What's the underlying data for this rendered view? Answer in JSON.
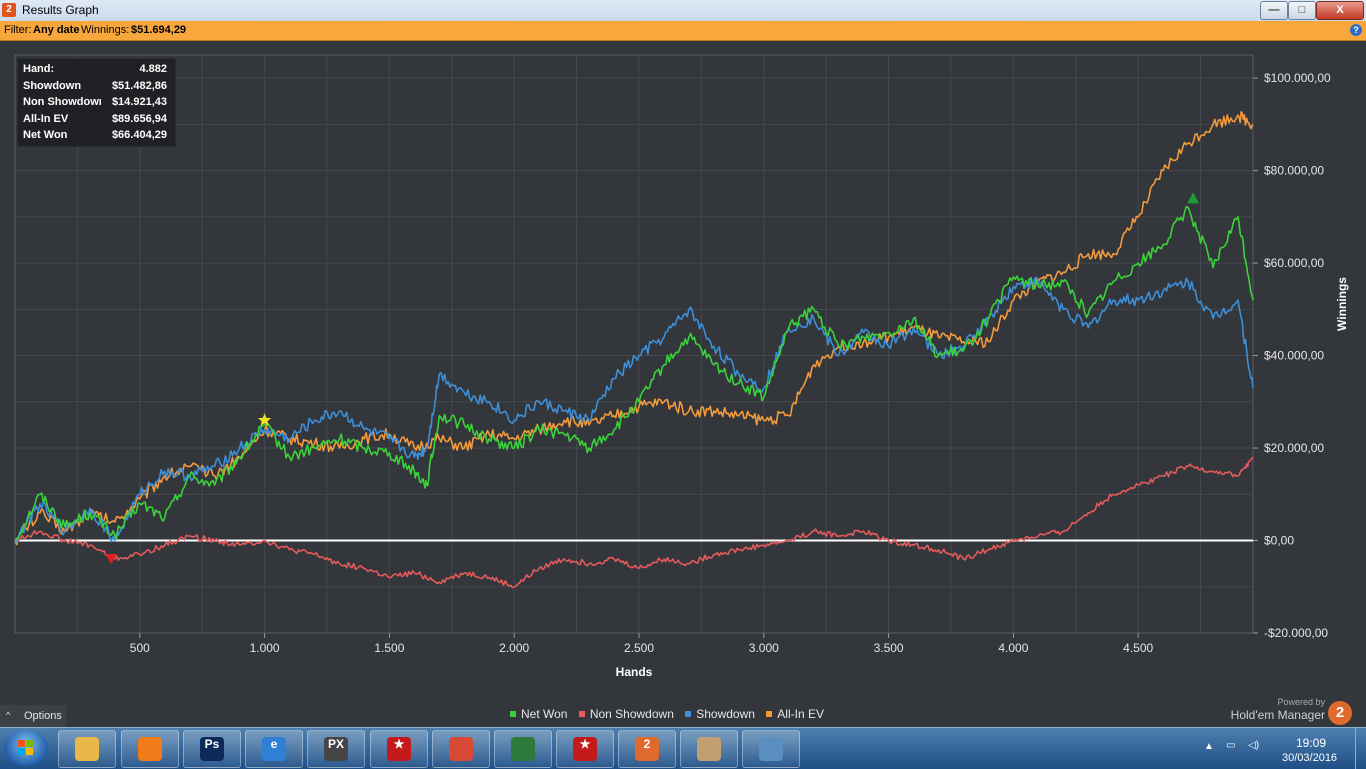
{
  "window": {
    "title": "Results Graph",
    "app_icon_text": "2",
    "buttons": {
      "minimize": "—",
      "maximize": "□",
      "close": "X"
    }
  },
  "filter_bar": {
    "filter_label": "Filter:",
    "filter_value": "Any date",
    "winnings_label": "Winnings:",
    "winnings_value": "$51.694,29",
    "help_icon": "question-icon",
    "help_text": "?"
  },
  "stats_box": {
    "rows": [
      {
        "label": "Hand:",
        "value": "4.882"
      },
      {
        "label": "Showdown",
        "value": "$51.482,86"
      },
      {
        "label": "Non Showdown",
        "value": "$14.921,43"
      },
      {
        "label": "All-In EV",
        "value": "$89.656,94"
      },
      {
        "label": "Net Won",
        "value": "$66.404,29"
      }
    ]
  },
  "chart_data": {
    "type": "line",
    "xlabel": "Hands",
    "ylabel": "Winnings",
    "xlim": [
      0,
      4960
    ],
    "ylim": [
      -20000,
      105000
    ],
    "x_ticks": [
      500,
      1000,
      1500,
      2000,
      2500,
      3000,
      3500,
      4000,
      4500
    ],
    "x_tick_labels": [
      "500",
      "1.000",
      "1.500",
      "2.000",
      "2.500",
      "3.000",
      "3.500",
      "4.000",
      "4.500"
    ],
    "y_ticks": [
      -20000,
      0,
      20000,
      40000,
      60000,
      80000,
      100000
    ],
    "y_tick_labels": [
      "-$20.000,00",
      "$0,00",
      "$20.000,00",
      "$40.000,00",
      "$60.000,00",
      "$80.000,00",
      "$100.000,00"
    ],
    "y_axis_position": "right",
    "grid": true,
    "legend_position": "bottom-center",
    "zero_line_color": "#ffffff",
    "series": [
      {
        "name": "Net Won",
        "color": "#3ad23a",
        "x": [
          0,
          100,
          200,
          300,
          400,
          500,
          600,
          700,
          800,
          900,
          1000,
          1100,
          1200,
          1300,
          1400,
          1500,
          1600,
          1650,
          1700,
          1800,
          1900,
          2000,
          2100,
          2200,
          2300,
          2400,
          2500,
          2600,
          2700,
          2800,
          2900,
          3000,
          3100,
          3200,
          3300,
          3400,
          3500,
          3600,
          3700,
          3800,
          3900,
          4000,
          4100,
          4200,
          4300,
          4400,
          4500,
          4600,
          4700,
          4800,
          4900,
          4960
        ],
        "y": [
          0,
          10000,
          3000,
          6000,
          1000,
          8000,
          5000,
          14000,
          12000,
          18000,
          25000,
          18000,
          20000,
          22000,
          20000,
          19000,
          15000,
          12000,
          27000,
          25000,
          22000,
          20000,
          24000,
          23000,
          20000,
          24000,
          30000,
          38000,
          44000,
          38000,
          34000,
          31000,
          46000,
          50000,
          42000,
          44000,
          45000,
          48000,
          40000,
          41000,
          48000,
          57000,
          55000,
          56000,
          49000,
          56000,
          60000,
          64000,
          72000,
          59000,
          70000,
          52000
        ]
      },
      {
        "name": "Non Showdown",
        "color": "#e55a5a",
        "x": [
          0,
          100,
          200,
          300,
          400,
          500,
          600,
          700,
          800,
          900,
          1000,
          1100,
          1200,
          1300,
          1400,
          1500,
          1600,
          1700,
          1800,
          1900,
          2000,
          2100,
          2200,
          2300,
          2400,
          2500,
          2600,
          2700,
          2800,
          2900,
          3000,
          3100,
          3200,
          3300,
          3400,
          3500,
          3600,
          3700,
          3800,
          3900,
          4000,
          4100,
          4200,
          4300,
          4400,
          4500,
          4600,
          4700,
          4800,
          4900,
          4960
        ],
        "y": [
          0,
          2000,
          0,
          -1000,
          -4000,
          -3000,
          -1000,
          1000,
          0,
          -1000,
          0,
          -2000,
          -3000,
          -5000,
          -6000,
          -8000,
          -7000,
          -9000,
          -7000,
          -8000,
          -10000,
          -6000,
          -4000,
          -5000,
          -4000,
          -6000,
          -4000,
          -5000,
          -3000,
          -2000,
          -1000,
          0,
          2000,
          1000,
          2000,
          0,
          -1000,
          -2000,
          -4000,
          -2000,
          0,
          1000,
          2000,
          6000,
          10000,
          12000,
          14000,
          16000,
          15000,
          14000,
          18000
        ]
      },
      {
        "name": "Showdown",
        "color": "#3d8fd9",
        "x": [
          0,
          100,
          200,
          300,
          400,
          500,
          600,
          700,
          800,
          900,
          1000,
          1100,
          1200,
          1300,
          1400,
          1500,
          1600,
          1650,
          1700,
          1800,
          1900,
          2000,
          2100,
          2200,
          2300,
          2400,
          2500,
          2600,
          2700,
          2800,
          2900,
          3000,
          3100,
          3200,
          3300,
          3400,
          3500,
          3600,
          3700,
          3800,
          3900,
          4000,
          4100,
          4200,
          4300,
          4400,
          4500,
          4600,
          4700,
          4800,
          4900,
          4960
        ],
        "y": [
          0,
          8000,
          2000,
          7000,
          0,
          10000,
          15000,
          14000,
          16000,
          20000,
          24000,
          22000,
          26000,
          28000,
          24000,
          22000,
          18000,
          20000,
          36000,
          32000,
          30000,
          26000,
          30000,
          28000,
          26000,
          35000,
          40000,
          44000,
          50000,
          42000,
          36000,
          33000,
          46000,
          48000,
          40000,
          45000,
          42000,
          46000,
          40000,
          42000,
          48000,
          55000,
          56000,
          50000,
          46000,
          52000,
          52000,
          54000,
          56000,
          48000,
          52000,
          33000
        ]
      },
      {
        "name": "All-In EV",
        "color": "#f39a3c",
        "x": [
          0,
          100,
          200,
          300,
          400,
          500,
          600,
          700,
          800,
          900,
          1000,
          1100,
          1200,
          1300,
          1400,
          1500,
          1600,
          1700,
          1800,
          1900,
          2000,
          2100,
          2200,
          2300,
          2400,
          2500,
          2600,
          2700,
          2800,
          2900,
          3000,
          3100,
          3200,
          3300,
          3400,
          3500,
          3600,
          3700,
          3800,
          3900,
          4000,
          4100,
          4200,
          4300,
          4400,
          4500,
          4600,
          4700,
          4800,
          4900,
          4960
        ],
        "y": [
          0,
          6000,
          2000,
          6000,
          4000,
          9000,
          14000,
          16000,
          14000,
          18000,
          24000,
          22000,
          21000,
          20000,
          22000,
          23000,
          20000,
          22000,
          20000,
          23000,
          22000,
          24000,
          26000,
          25000,
          27000,
          29000,
          30000,
          28000,
          28000,
          27000,
          26000,
          27000,
          38000,
          42000,
          43000,
          44000,
          46000,
          44000,
          43000,
          43000,
          52000,
          56000,
          58000,
          62000,
          62000,
          70000,
          80000,
          86000,
          90000,
          92000,
          90000
        ]
      }
    ],
    "markers": [
      {
        "type": "star",
        "x": 1000,
        "y": 26000,
        "color": "#f5e21c"
      },
      {
        "type": "triangle-down",
        "x": 385,
        "y": -4000,
        "color": "#e02020"
      },
      {
        "type": "triangle-up",
        "x": 4720,
        "y": 74000,
        "color": "#1f9a3a"
      }
    ]
  },
  "legend": {
    "items": [
      {
        "label": "Net Won",
        "color": "#3ad23a"
      },
      {
        "label": "Non Showdown",
        "color": "#e55a5a"
      },
      {
        "label": "Showdown",
        "color": "#3d8fd9"
      },
      {
        "label": "All-In EV",
        "color": "#f39a3c"
      }
    ]
  },
  "options_button": {
    "label": "Options",
    "caret": "^"
  },
  "branding": {
    "powered_by": "Powered by",
    "product": "Hold'em Manager",
    "logo_text": "2"
  },
  "taskbar": {
    "apps": [
      {
        "name": "file-explorer-icon",
        "color": "#e8b84a",
        "text": ""
      },
      {
        "name": "blender-icon",
        "color": "#f07c1a",
        "text": ""
      },
      {
        "name": "photoshop-icon",
        "color": "#0b2a5a",
        "text": "Ps"
      },
      {
        "name": "internet-explorer-icon",
        "color": "#2f7fd4",
        "text": "e"
      },
      {
        "name": "px-app-icon",
        "color": "#444444",
        "text": "PX"
      },
      {
        "name": "pokerstars-icon",
        "color": "#c31b1b",
        "text": "★"
      },
      {
        "name": "chrome-icon",
        "color": "#d64a36",
        "text": ""
      },
      {
        "name": "poker-app-icon",
        "color": "#2d7a3a",
        "text": ""
      },
      {
        "name": "pokerstars-icon-2",
        "color": "#c31b1b",
        "text": "★"
      },
      {
        "name": "holdem-manager-icon",
        "color": "#e06a2c",
        "text": "2"
      },
      {
        "name": "paint-icon",
        "color": "#c0a070",
        "text": ""
      },
      {
        "name": "photo-viewer-icon",
        "color": "#5a8fc0",
        "text": ""
      }
    ],
    "clock": {
      "time": "19:09",
      "date": "30/03/2016"
    }
  }
}
